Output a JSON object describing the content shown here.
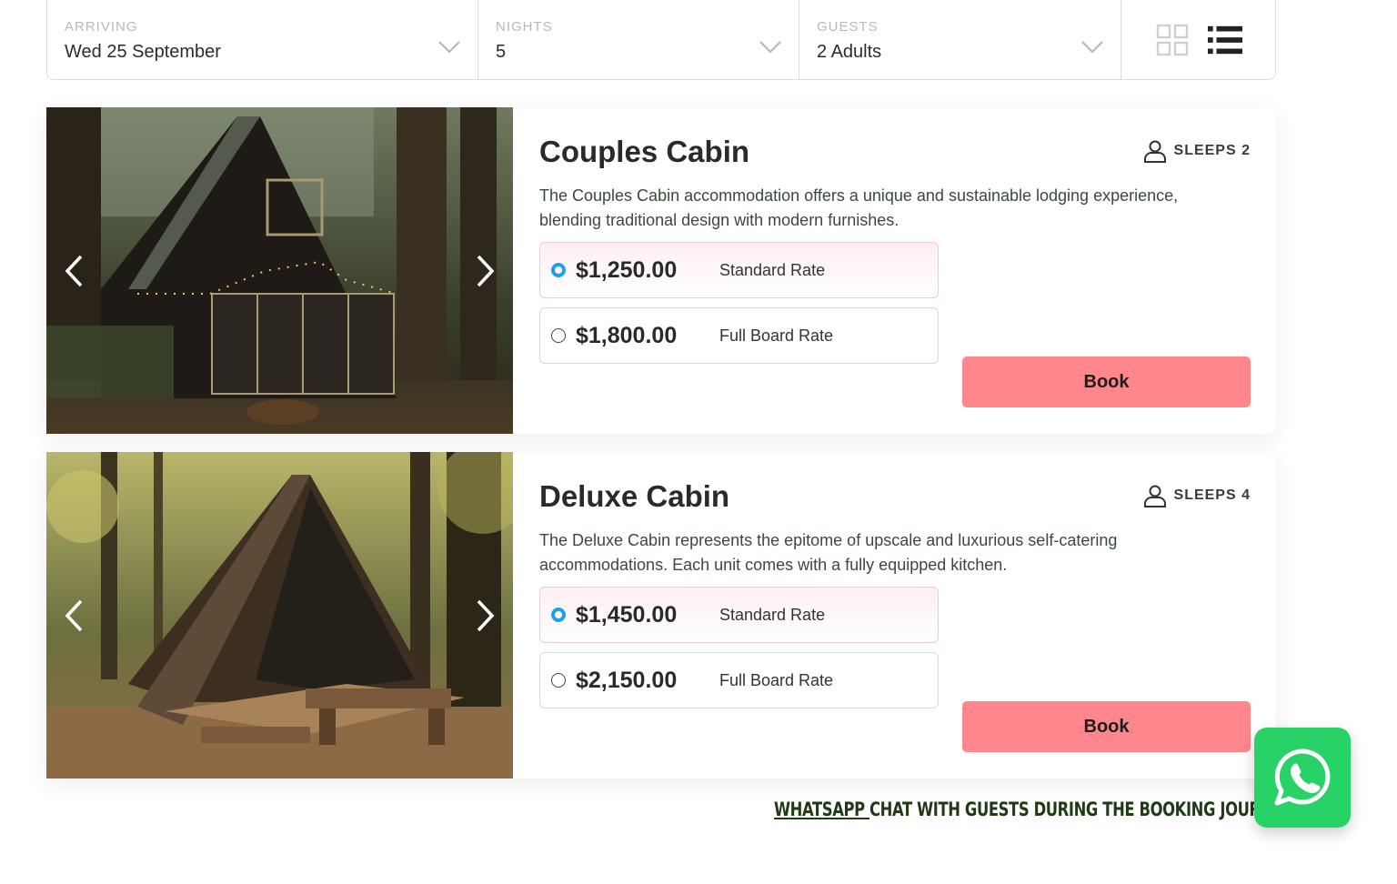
{
  "search": {
    "arriving": {
      "label": "ARRIVING",
      "value": "Wed 25 September"
    },
    "nights": {
      "label": "NIGHTS",
      "value": "5"
    },
    "guests": {
      "label": "GUESTS",
      "value": "2 Adults"
    },
    "views": [
      "grid-view-icon",
      "list-view-icon"
    ]
  },
  "cabins": [
    {
      "title": "Couples Cabin",
      "sleeps": "SLEEPS 2",
      "description": "The Couples Cabin accommodation offers a unique and sustainable lodging experience, blending traditional design with modern furnishes.",
      "rates": [
        {
          "price": "$1,250.00",
          "name": "Standard Rate",
          "selected": true
        },
        {
          "price": "$1,800.00",
          "name": "Full Board Rate",
          "selected": false
        }
      ],
      "book_label": "Book"
    },
    {
      "title": "Deluxe Cabin",
      "sleeps": "SLEEPS 4",
      "description": "The Deluxe Cabin represents the epitome of upscale and luxurious self-catering accommodations. Each unit comes with a fully equipped kitchen.",
      "rates": [
        {
          "price": "$1,450.00",
          "name": "Standard Rate",
          "selected": true
        },
        {
          "price": "$2,150.00",
          "name": "Full Board Rate",
          "selected": false
        }
      ],
      "book_label": "Book"
    }
  ],
  "footer": {
    "caption_underlined": "WHATSAPP ",
    "caption_rest": "CHAT WITH GUESTS DURING THE BOOKING JOURNEY"
  },
  "colors": {
    "book": "#ff868c",
    "radio_selected": "#1aa3e8",
    "whatsapp": "#27d366",
    "caption": "#1f3a14"
  }
}
